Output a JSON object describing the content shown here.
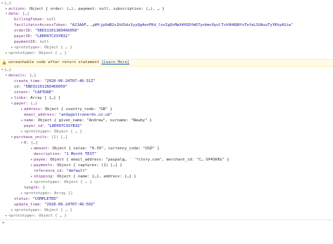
{
  "top": {
    "root_summary": "{…}",
    "actions": {
      "key": "actions:",
      "value": "Object { order: (…), payment: null, subscription: (…), … }"
    },
    "data": {
      "key": "data:",
      "value": "{…}"
    },
    "billingToken": {
      "key": "billingToken:",
      "value": "null"
    },
    "facilitatorAccessToken": {
      "key": "facilitatorAccessToken:",
      "value": "\"A21AAF…  …pHtjpXmB2v1hUSdz1yyQg4evPKd_lnzIgQvMwX4VGDfmD7ynbmc0yulTsh9hNQ8foTefeLSUAuuTyYKhyASiw\""
    },
    "orderID": {
      "key": "orderID:",
      "value": "\"5BD311011N3466050\""
    },
    "payerID": {
      "key": "payerID:",
      "value": "\"L8EH97CXSYB32\""
    },
    "paymentID": {
      "key": "paymentID:",
      "value": "null"
    },
    "data_proto": {
      "key": "<prototype>:",
      "value": "Object { … }"
    },
    "root_proto": {
      "key": "<prototype>:",
      "value": "Object { … }"
    }
  },
  "warning": {
    "text": "unreachable code after return statement",
    "link": "[Learn More]"
  },
  "bottom": {
    "root_summary": "{…}",
    "details": {
      "key": "details:",
      "value": "{…}"
    },
    "create_time": {
      "key": "create_time:",
      "value": "\"2020-06-24T07:46:31Z\""
    },
    "id": {
      "key": "id:",
      "value": "\"5BD311011N3466050\""
    },
    "intent": {
      "key": "intent:",
      "value": "\"CAPTURE\""
    },
    "links": {
      "key": "links:",
      "value": "Array [ {…} ]"
    },
    "payer": {
      "key": "payer:",
      "value": "{…}"
    },
    "address": {
      "key": "address:",
      "value": "Object { country_code: \"GB\" }"
    },
    "email_address": {
      "key": "email_address:",
      "value": "\"andy@ultranerds.co.uk\""
    },
    "name": {
      "key": "name:",
      "value": "Object { given_name: \"Andrew\", surname: \"Newby\" }"
    },
    "payer_id": {
      "key": "payer_id:",
      "value": "\"L8EH97CXSYB32\""
    },
    "payer_proto": {
      "key": "<prototype>:",
      "value": "Object { … }"
    },
    "purchase_units": {
      "key": "purchase_units:",
      "value": "(1) […]"
    },
    "pu0": {
      "key": "0:",
      "value": "{…}"
    },
    "amount": {
      "key": "amount:",
      "value": "Object { value: \"0.39\", currency_code: \"USD\" }"
    },
    "description": {
      "key": "description:",
      "value": "\"1 Month TEST\""
    },
    "payee": {
      "key": "payee:",
      "value": "Object { email_address: \"paypal@…  ` '*ctory.com\", merchant_id: \"C…   UP4SKKG\" }"
    },
    "payments": {
      "key": "payments:",
      "value": "Object { captures: (1) […] }"
    },
    "reference_id": {
      "key": "reference_id:",
      "value": "\"default\""
    },
    "shipping": {
      "key": "shipping:",
      "value": "Object { name: {…}, address: {…} }"
    },
    "pu0_proto": {
      "key": "<prototype>:",
      "value": "Object { … }"
    },
    "length": {
      "key": "length:",
      "value": "1"
    },
    "pu_proto": {
      "key": "<prototype>:",
      "value": "Array []"
    },
    "status": {
      "key": "status:",
      "value": "\"COMPLETED\""
    },
    "update_time": {
      "key": "update_time:",
      "value": "\"2020-06-24T07:46:50Z\""
    },
    "details_proto": {
      "key": "<prototype>:",
      "value": "Object { … }"
    },
    "root_proto": {
      "key": "<prototype>:",
      "value": "Object { … }"
    }
  },
  "prompt_symbol": "»"
}
